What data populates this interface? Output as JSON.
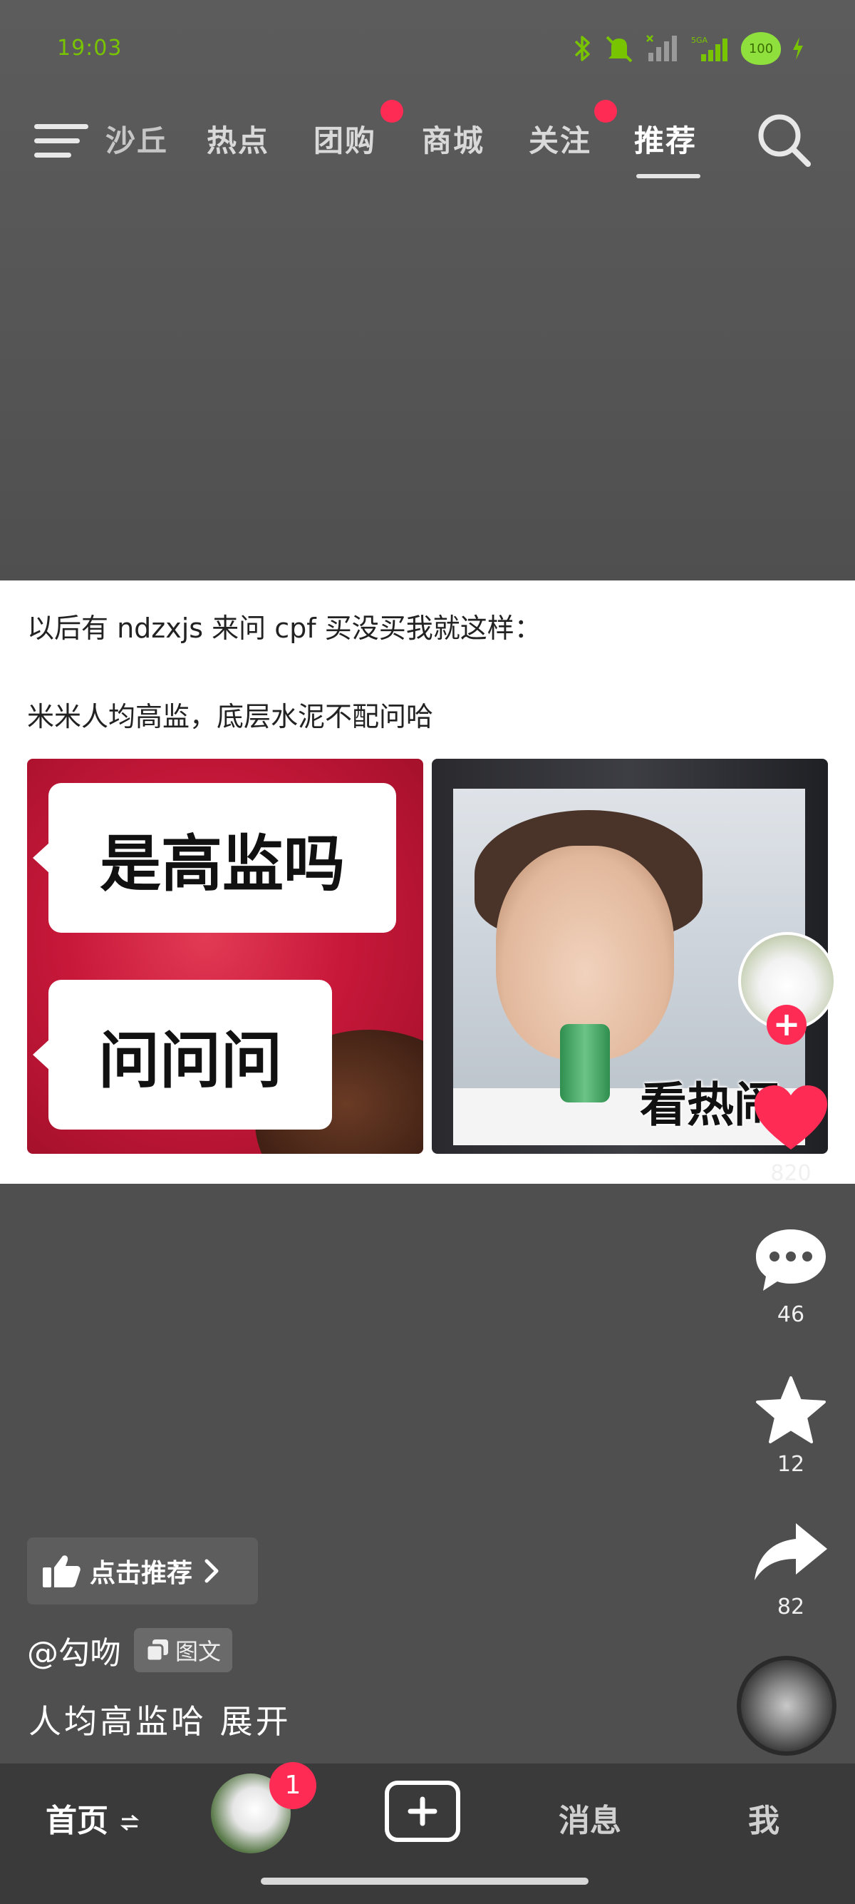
{
  "status_bar": {
    "time": "19:03",
    "network": "5GA",
    "battery": "100"
  },
  "top_nav": {
    "tabs": [
      {
        "label": "沙丘",
        "active": false,
        "dot": false
      },
      {
        "label": "热点",
        "active": false,
        "dot": false
      },
      {
        "label": "团购",
        "active": false,
        "dot": true
      },
      {
        "label": "商城",
        "active": false,
        "dot": false
      },
      {
        "label": "关注",
        "active": false,
        "dot": true
      },
      {
        "label": "推荐",
        "active": true,
        "dot": false
      }
    ]
  },
  "post": {
    "line1": "以后有 ndzxjs 来问 cpf 买没买我就这样：",
    "line2": "米米人均高监，底层水泥不配问哈",
    "image_left": {
      "bubble1": "是高监吗",
      "bubble2": "问问问"
    },
    "image_right": {
      "caption": "看热闹"
    }
  },
  "actions": {
    "likes": "820",
    "comments": "46",
    "favorites": "12",
    "shares": "82"
  },
  "author": {
    "name": "@勾吻",
    "type_tag": "图文"
  },
  "recommend_button": "点击推荐",
  "description": "人均高监哈 展开",
  "bottom_nav": {
    "home": "首页",
    "friend_badge": "1",
    "messages": "消息",
    "me": "我"
  },
  "colors": {
    "accent": "#fe2c55",
    "status_green": "#79c400",
    "background": "#4f4f4f"
  },
  "icons": [
    "menu-icon",
    "search-icon",
    "heart-icon",
    "comment-icon",
    "star-icon",
    "share-icon",
    "thumbs-up-icon",
    "chevron-right-icon",
    "plus-icon",
    "swap-icon"
  ]
}
